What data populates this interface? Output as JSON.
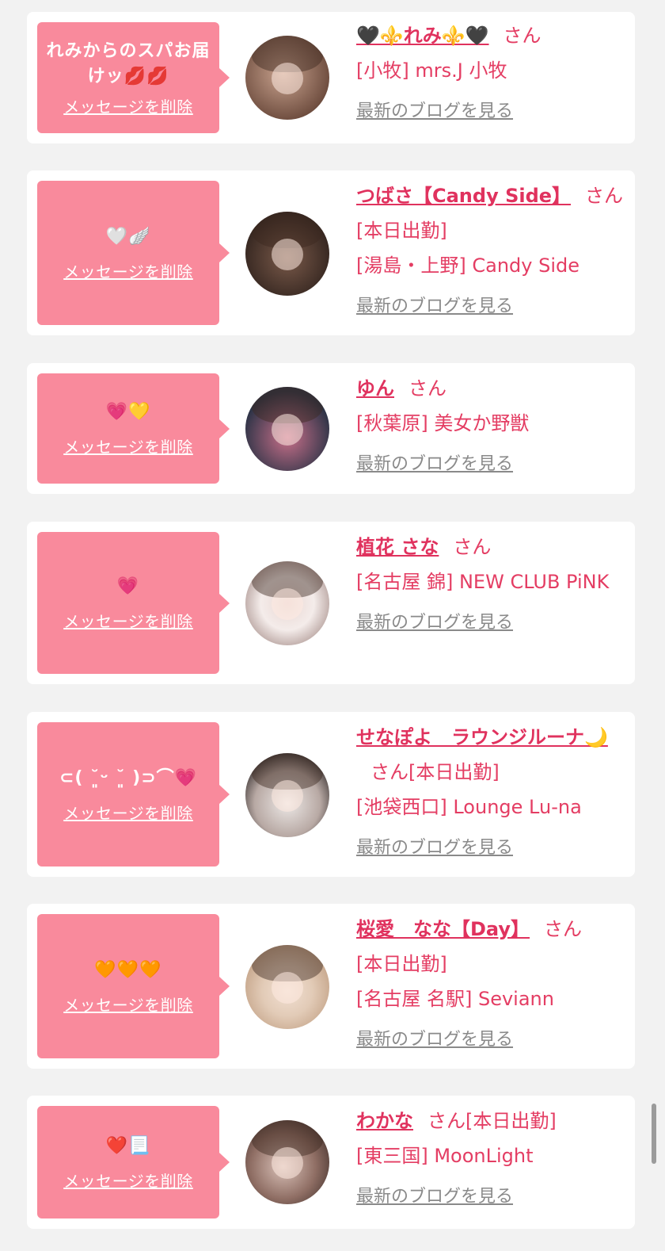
{
  "colors": {
    "bubble": "#f98a9c",
    "name": "#e0325e",
    "text": "#e43d63",
    "blog_link": "#8a8a8a",
    "background": "#f2f2f2"
  },
  "cards": [
    {
      "message": "れみからのスパお届けッ💋💋",
      "delete_label": "メッセージを削除",
      "name": "🖤⚜️れみ⚜️🖤",
      "honorific": "さん",
      "status": "",
      "shop": "[小牧] mrs.J 小牧",
      "blog_label": "最新のブログを見る",
      "avatar_colors": [
        "#c9a38f",
        "#6b4a3c"
      ]
    },
    {
      "message": "🤍🪽",
      "delete_label": "メッセージを削除",
      "name": "つばさ【Candy Side】",
      "honorific": "さん",
      "status": "[本日出勤]",
      "shop": "[湯島・上野] Candy Side",
      "blog_label": "最新のブログを見る",
      "avatar_colors": [
        "#7a5a4a",
        "#2e211c"
      ]
    },
    {
      "message": "💗💛",
      "delete_label": "メッセージを削除",
      "name": "ゆん",
      "honorific": "さん",
      "status": "",
      "shop": "[秋葉原] 美女か野獣",
      "blog_label": "最新のブログを見る",
      "avatar_colors": [
        "#2c3346",
        "#c9708a"
      ]
    },
    {
      "message": "💗",
      "delete_label": "メッセージを削除",
      "name": "植花 さな",
      "honorific": "さん",
      "status": "",
      "shop": "[名古屋 錦] NEW CLUB PiNK",
      "blog_label": "最新のブログを見る",
      "avatar_colors": [
        "#f4ecea",
        "#8c6f6a"
      ]
    },
    {
      "message": "⊂( ˘͈ᵕ ˘͈ )⊃⌒💗",
      "delete_label": "メッセージを削除",
      "name": "せなぽよ　ラウンジルーナ🌙",
      "honorific": "さん",
      "status": "[本日出勤]",
      "shop": "[池袋西口] Lounge Lu-na",
      "blog_label": "最新のブログを見る",
      "avatar_colors": [
        "#ece8e6",
        "#1f1a1a"
      ]
    },
    {
      "message": "🧡🧡🧡",
      "delete_label": "メッセージを削除",
      "name": "桜愛　なな【Day】",
      "honorific": "さん",
      "status": "[本日出勤]",
      "shop": "[名古屋 名駅] Seviann",
      "blog_label": "最新のブログを見る",
      "avatar_colors": [
        "#e2cbb7",
        "#b99577"
      ]
    },
    {
      "message": "❤️📃",
      "delete_label": "メッセージを削除",
      "name": "わかな",
      "honorific": "さん",
      "status": "[本日出勤]",
      "shop": "[東三国] MoonLight",
      "blog_label": "最新のブログを見る",
      "avatar_colors": [
        "#d9c1b8",
        "#3a2a26"
      ]
    }
  ]
}
